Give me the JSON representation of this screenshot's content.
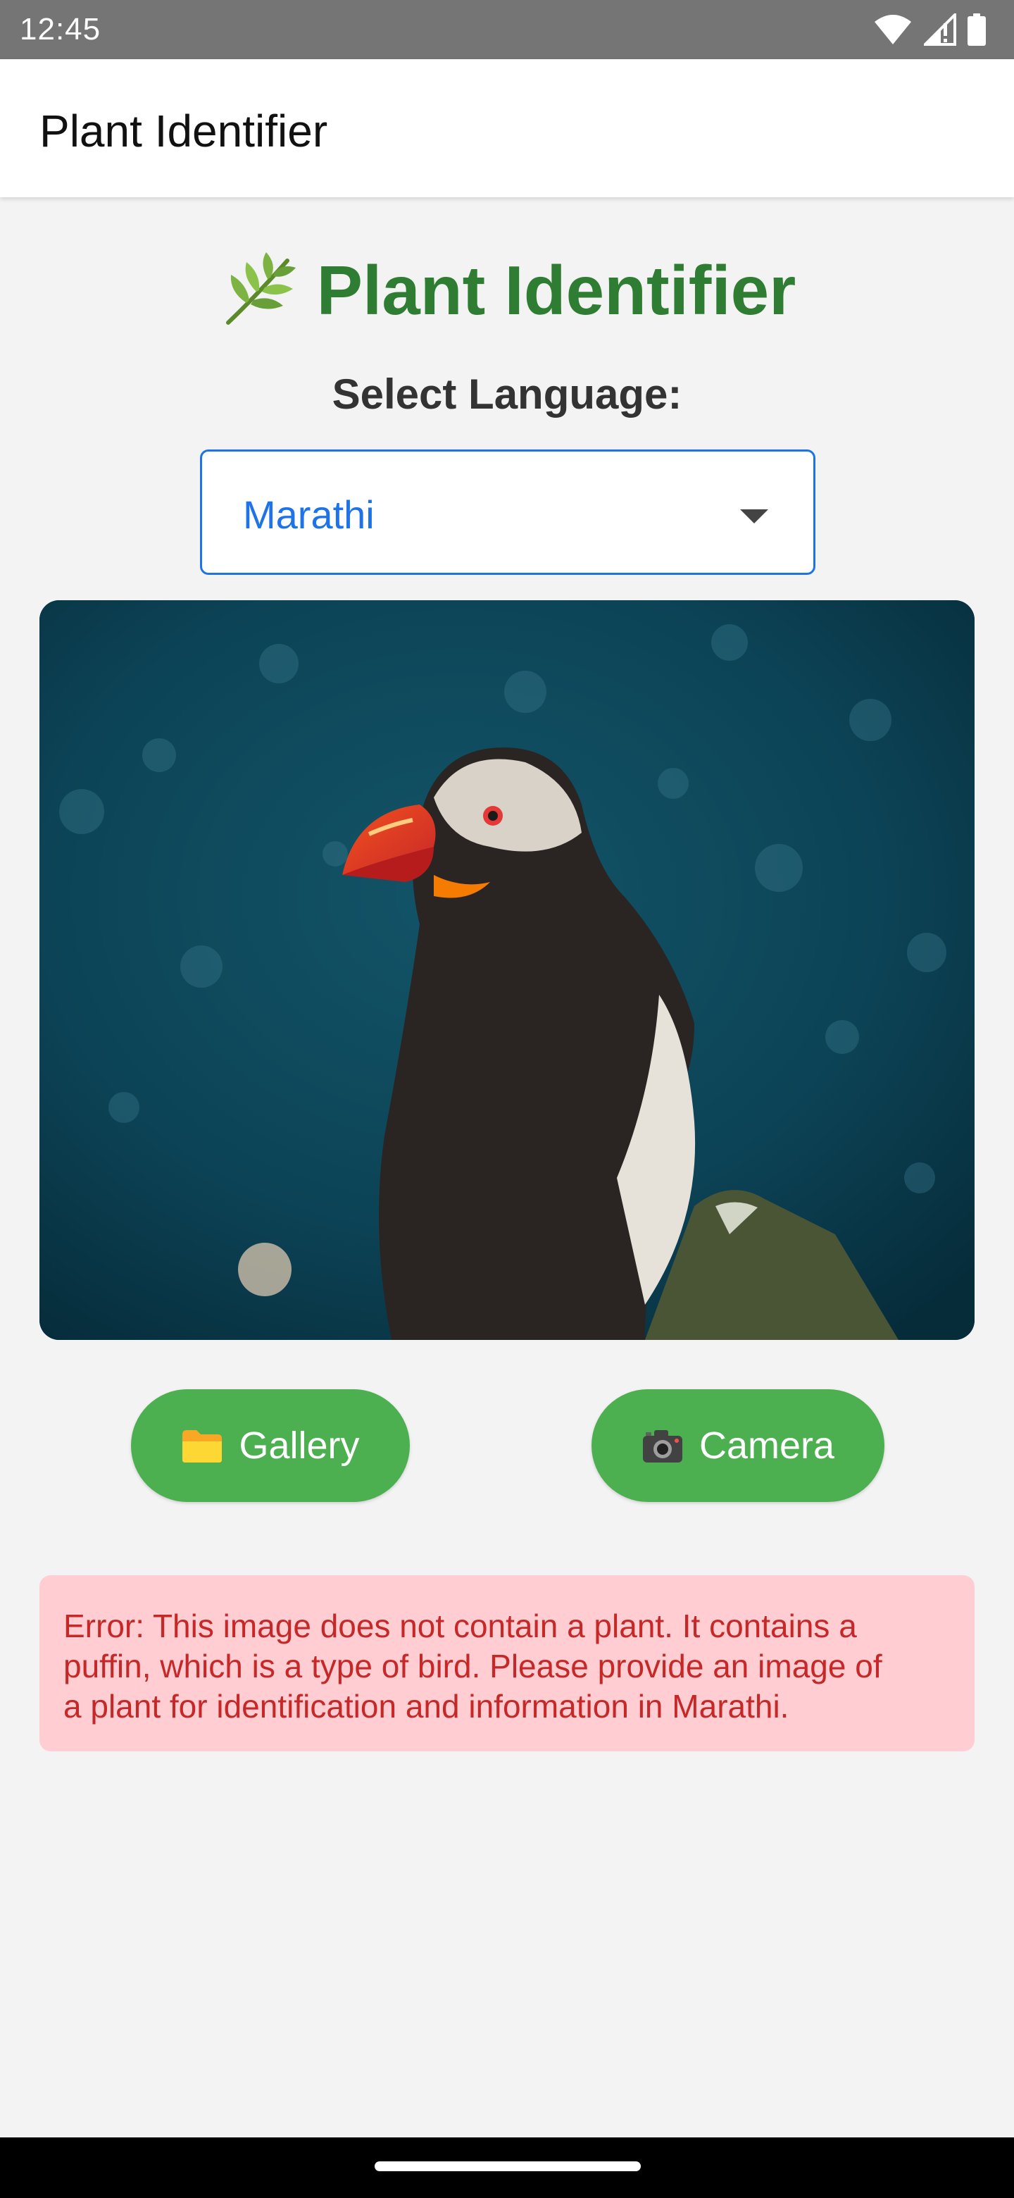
{
  "status_bar": {
    "time": "12:45",
    "icons": [
      "wifi-icon",
      "signal-icon",
      "battery-icon"
    ]
  },
  "app_bar": {
    "title": "Plant Identifier"
  },
  "main": {
    "heading_icon": "leaf-icon",
    "heading": "Plant Identifier",
    "language_label": "Select Language:",
    "language_select": {
      "value": "Marathi"
    },
    "image": {
      "subject": "puffin-photo"
    },
    "buttons": {
      "gallery": {
        "icon": "folder-icon",
        "label": "Gallery"
      },
      "camera": {
        "icon": "camera-icon",
        "label": "Camera"
      }
    },
    "error_message": "Error: This image does not contain a plant. It contains a\npuffin, which is a type of bird.  Please provide an image of\na plant for identification and information in Marathi."
  },
  "colors": {
    "status_bar": "#757575",
    "heading_green": "#2e7d32",
    "button_green": "#4caf50",
    "select_blue": "#1e73e8",
    "error_bg": "#ffcdd2",
    "error_text": "#c62828",
    "page_bg": "#f3f3f3"
  }
}
